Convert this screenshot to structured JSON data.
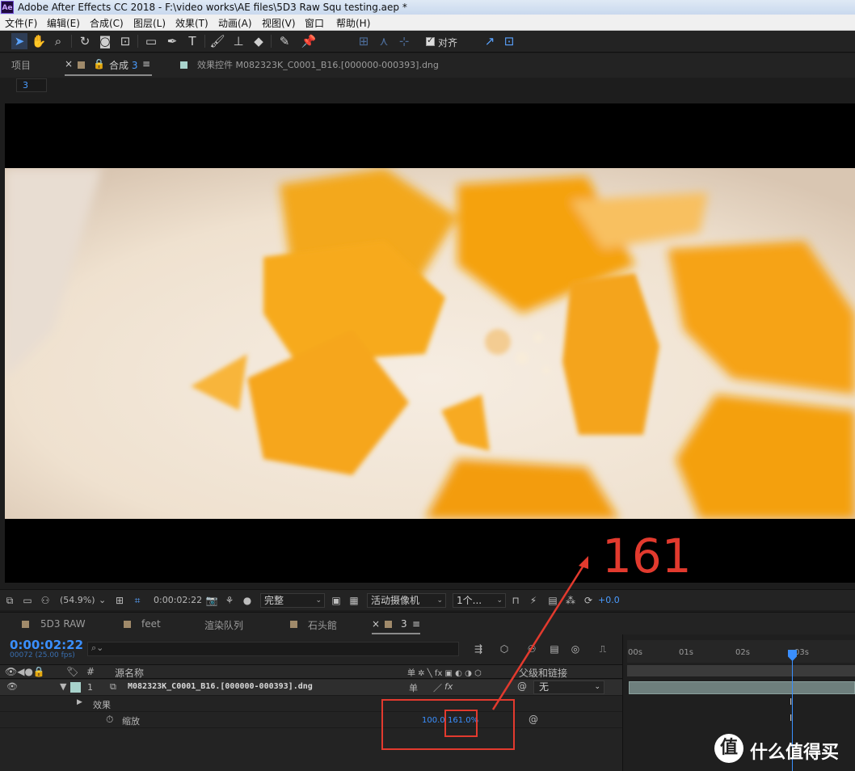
{
  "window": {
    "title": "Adobe After Effects CC 2018 - F:\\video works\\AE files\\5D3 Raw Squ testing.aep *",
    "logo_text": "Ae"
  },
  "menu": [
    "文件(F)",
    "编辑(E)",
    "合成(C)",
    "图层(L)",
    "效果(T)",
    "动画(A)",
    "视图(V)",
    "窗口",
    "帮助(H)"
  ],
  "toolbar": {
    "snap_label": "对齐",
    "snap_checked": true
  },
  "top_panel": {
    "project_tab": "项目",
    "comp_tab_label": "合成",
    "comp_tab_number": "3",
    "effects_tab": "效果控件 M082323K_C0001_B16.[000000-000393].dng",
    "comp_name_field": "3"
  },
  "viewer_bar": {
    "zoom": "(54.9%)",
    "timecode": "0:00:02:22",
    "resolution": "完整",
    "camera": "活动摄像机",
    "views": "1个...",
    "exposure": "+0.0"
  },
  "timeline_tabs": [
    "5D3 RAW",
    "feet",
    "渲染队列",
    "石头館",
    "3"
  ],
  "timeline": {
    "timecode": "0:00:02:22",
    "frame_info": "00072 (25.00 fps)",
    "search_icon": "search-icon",
    "columns": {
      "source_name": "源名称",
      "number": "#",
      "parent": "父级和链接"
    },
    "layer": {
      "index": "1",
      "name": "M082323K_C0001_B16.[000000-000393].dng",
      "parent": "无"
    },
    "effects_label": "效果",
    "scale_label": "缩放",
    "scale_value_1": "100.0",
    "scale_value_2": "161.0%",
    "ruler": [
      "00s",
      "01s",
      "02s",
      "03s"
    ]
  },
  "annotation": {
    "handwritten": "161",
    "color": "#e23a2e"
  },
  "watermark": {
    "logo": "值",
    "text": "什么值得买"
  },
  "colors": {
    "accent_blue": "#3a8fff",
    "panel_bg": "#232323",
    "mango_orange": "#f5a20f"
  }
}
